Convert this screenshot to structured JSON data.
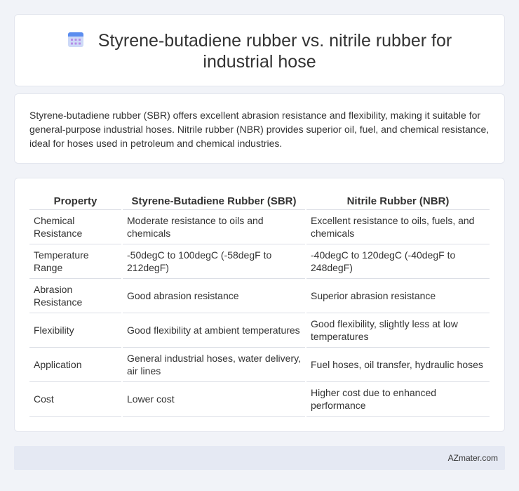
{
  "header": {
    "title": "Styrene-butadiene rubber vs. nitrile rubber for industrial hose",
    "icon": "calendar-icon"
  },
  "intro": {
    "text": "Styrene-butadiene rubber (SBR) offers excellent abrasion resistance and flexibility, making it suitable for general-purpose industrial hoses. Nitrile rubber (NBR) provides superior oil, fuel, and chemical resistance, ideal for hoses used in petroleum and chemical industries."
  },
  "table": {
    "headers": [
      "Property",
      "Styrene-Butadiene Rubber (SBR)",
      "Nitrile Rubber (NBR)"
    ],
    "rows": [
      [
        "Chemical Resistance",
        "Moderate resistance to oils and chemicals",
        "Excellent resistance to oils, fuels, and chemicals"
      ],
      [
        "Temperature Range",
        "-50degC to 100degC (-58degF to 212degF)",
        "-40degC to 120degC (-40degF to 248degF)"
      ],
      [
        "Abrasion Resistance",
        "Good abrasion resistance",
        "Superior abrasion resistance"
      ],
      [
        "Flexibility",
        "Good flexibility at ambient temperatures",
        "Good flexibility, slightly less at low temperatures"
      ],
      [
        "Application",
        "General industrial hoses, water delivery, air lines",
        "Fuel hoses, oil transfer, hydraulic hoses"
      ],
      [
        "Cost",
        "Lower cost",
        "Higher cost due to enhanced performance"
      ]
    ]
  },
  "footer": {
    "brand": "AZmater.com"
  },
  "colors": {
    "background": "#f1f3f8",
    "card": "#ffffff",
    "footer": "#e5e9f3",
    "icon_top": "#5b8def",
    "icon_body": "#cdd9f7",
    "icon_dots": "#b58be8"
  }
}
